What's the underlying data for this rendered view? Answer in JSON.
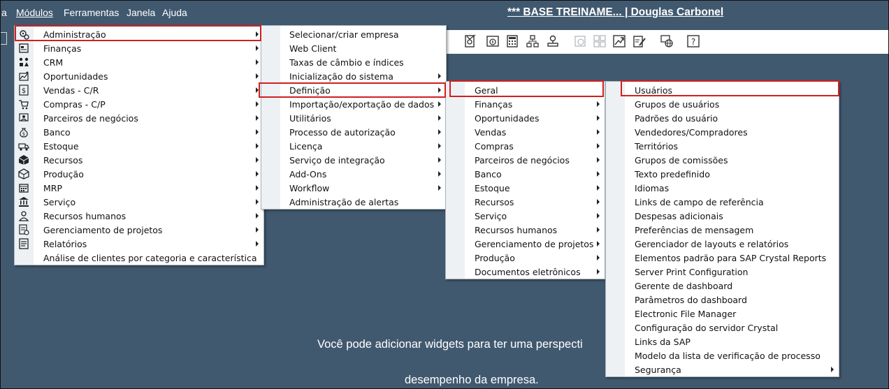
{
  "menubar": {
    "items": [
      "a",
      "Módulos",
      "Ferramentas",
      "Janela",
      "Ajuda"
    ],
    "title": "*** BASE TREINAME... | Douglas Carbonel"
  },
  "modules_menu": [
    {
      "label": "Administração",
      "icon": "gears-icon",
      "submenu": true
    },
    {
      "label": "Finanças",
      "icon": "finance-icon",
      "submenu": true
    },
    {
      "label": "CRM",
      "icon": "crm-icon",
      "submenu": true
    },
    {
      "label": "Oportunidades",
      "icon": "opportunities-icon",
      "submenu": true
    },
    {
      "label": "Vendas - C/R",
      "icon": "dollar-icon",
      "submenu": true
    },
    {
      "label": "Compras - C/P",
      "icon": "cart-icon",
      "submenu": true
    },
    {
      "label": "Parceiros de negócios",
      "icon": "partners-icon",
      "submenu": true
    },
    {
      "label": "Banco",
      "icon": "moneybag-icon",
      "submenu": true
    },
    {
      "label": "Estoque",
      "icon": "truck-icon",
      "submenu": true
    },
    {
      "label": "Recursos",
      "icon": "box-icon",
      "submenu": true
    },
    {
      "label": "Produção",
      "icon": "cube-icon",
      "submenu": true
    },
    {
      "label": "MRP",
      "icon": "calendar-icon",
      "submenu": true
    },
    {
      "label": "Serviço",
      "icon": "bank-icon",
      "submenu": true
    },
    {
      "label": "Recursos humanos",
      "icon": "person-icon",
      "submenu": true
    },
    {
      "label": "Gerenciamento de projetos",
      "icon": "project-icon",
      "submenu": true
    },
    {
      "label": "Relatórios",
      "icon": "report-icon",
      "submenu": true
    },
    {
      "label": "Análise de clientes por categoria e característica",
      "icon": "",
      "submenu": false
    }
  ],
  "admin_menu": [
    {
      "label": "Selecionar/criar empresa",
      "submenu": false
    },
    {
      "label": "Web Client",
      "submenu": false
    },
    {
      "label": "Taxas de câmbio e índices",
      "submenu": false
    },
    {
      "label": "Inicialização do sistema",
      "submenu": true
    },
    {
      "label": "Definição",
      "submenu": true
    },
    {
      "label": "Importação/exportação de dados",
      "submenu": true
    },
    {
      "label": "Utilitários",
      "submenu": true
    },
    {
      "label": "Processo de autorização",
      "submenu": true
    },
    {
      "label": "Licença",
      "submenu": true
    },
    {
      "label": "Serviço de integração",
      "submenu": true
    },
    {
      "label": "Add-Ons",
      "submenu": true
    },
    {
      "label": "Workflow",
      "submenu": true
    },
    {
      "label": "Administração de alertas",
      "submenu": false
    }
  ],
  "definicao_menu": [
    {
      "label": "Geral",
      "submenu": false
    },
    {
      "label": "Finanças",
      "submenu": true
    },
    {
      "label": "Oportunidades",
      "submenu": true
    },
    {
      "label": "Vendas",
      "submenu": true
    },
    {
      "label": "Compras",
      "submenu": true
    },
    {
      "label": "Parceiros de negócios",
      "submenu": true
    },
    {
      "label": "Banco",
      "submenu": true
    },
    {
      "label": "Estoque",
      "submenu": true
    },
    {
      "label": "Recursos",
      "submenu": true
    },
    {
      "label": "Serviço",
      "submenu": true
    },
    {
      "label": "Recursos humanos",
      "submenu": true
    },
    {
      "label": "Gerenciamento de projetos",
      "submenu": true
    },
    {
      "label": "Produção",
      "submenu": true
    },
    {
      "label": "Documentos eletrônicos",
      "submenu": true
    }
  ],
  "geral_menu": [
    {
      "label": "Usuários",
      "submenu": false
    },
    {
      "label": "Grupos de usuários",
      "submenu": false
    },
    {
      "label": "Padrões do usuário",
      "submenu": false
    },
    {
      "label": "Vendedores/Compradores",
      "submenu": false
    },
    {
      "label": "Territórios",
      "submenu": false
    },
    {
      "label": "Grupos de comissões",
      "submenu": false
    },
    {
      "label": "Texto predefinido",
      "submenu": false
    },
    {
      "label": "Idiomas",
      "submenu": false
    },
    {
      "label": "Links de campo de referência",
      "submenu": false
    },
    {
      "label": "Despesas adicionais",
      "submenu": false
    },
    {
      "label": "Preferências de mensagem",
      "submenu": false
    },
    {
      "label": "Gerenciador de layouts e relatórios",
      "submenu": false
    },
    {
      "label": "Elementos padrão para SAP Crystal Reports",
      "submenu": false
    },
    {
      "label": "Server Print Configuration",
      "submenu": false
    },
    {
      "label": "Gerente de dashboard",
      "submenu": false
    },
    {
      "label": "Parâmetros do dashboard",
      "submenu": false
    },
    {
      "label": "Electronic File Manager",
      "submenu": false
    },
    {
      "label": "Configuração do servidor Crystal",
      "submenu": false
    },
    {
      "label": "Links da SAP",
      "submenu": false
    },
    {
      "label": "Modelo da lista de verificação de processo",
      "submenu": false
    },
    {
      "label": "Segurança",
      "submenu": true
    }
  ],
  "toolbar_icons": [
    "approve-doc-icon",
    "doc-info-icon",
    "calculator-icon",
    "network-icon",
    "user-stamp-icon",
    "settings-disabled-icon",
    "grid-disabled-icon",
    "export-chart-icon",
    "edit-doc-icon",
    "globe-icon",
    "help-icon"
  ],
  "widget_message": {
    "line1": "Você pode adicionar widgets para ter uma perspecti",
    "line2": "desempenho da empresa."
  }
}
